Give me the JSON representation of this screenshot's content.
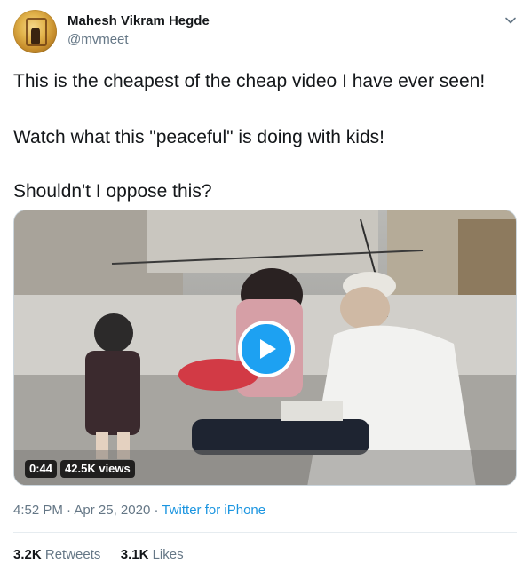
{
  "author": {
    "name": "Mahesh Vikram Hegde",
    "handle": "@mvmeet",
    "avatar_icon": "user-avatar"
  },
  "menu_icon": "chevron-down-icon",
  "tweet": {
    "lines": [
      "This is the cheapest of the cheap video I have ever seen!",
      "Watch what this \"peaceful\" is doing with kids!",
      "Shouldn't I oppose this?"
    ]
  },
  "media": {
    "play_icon": "play-icon",
    "duration": "0:44",
    "views": "42.5K views"
  },
  "meta": {
    "time": "4:52 PM",
    "separator1": "·",
    "date": "Apr 25, 2020",
    "separator2": "·",
    "source": "Twitter for iPhone"
  },
  "stats": {
    "retweets_count": "3.2K",
    "retweets_label": "Retweets",
    "likes_count": "3.1K",
    "likes_label": "Likes"
  },
  "colors": {
    "accent": "#1da1f2",
    "link": "#1b95e0",
    "secondary_text": "#657786",
    "divider": "#e6ecf0"
  }
}
